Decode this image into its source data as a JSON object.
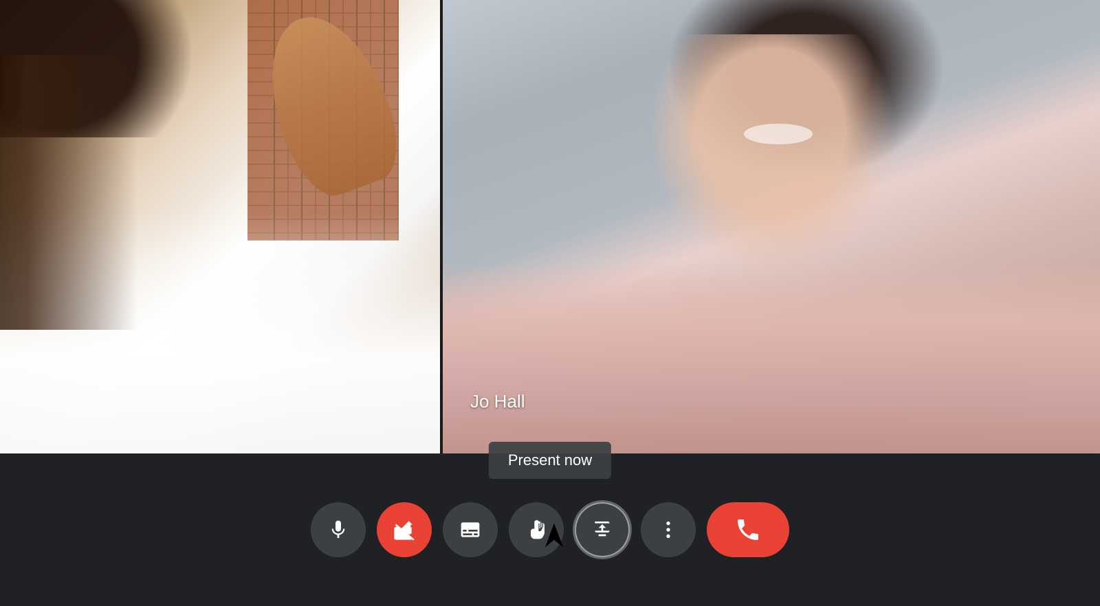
{
  "participants": {
    "left": {
      "name": ""
    },
    "right": {
      "name": "Jo Hall"
    }
  },
  "tooltip": {
    "text": "Present now"
  },
  "controls": {
    "mic_label": "Microphone",
    "camera_label": "Camera (off)",
    "captions_label": "Closed captions",
    "raise_hand_label": "Raise hand",
    "present_label": "Present now",
    "more_label": "More options",
    "end_label": "End call"
  },
  "colors": {
    "background": "#202124",
    "button_gray": "#3c4043",
    "button_red": "#ea4335",
    "icon_white": "#ffffff"
  }
}
